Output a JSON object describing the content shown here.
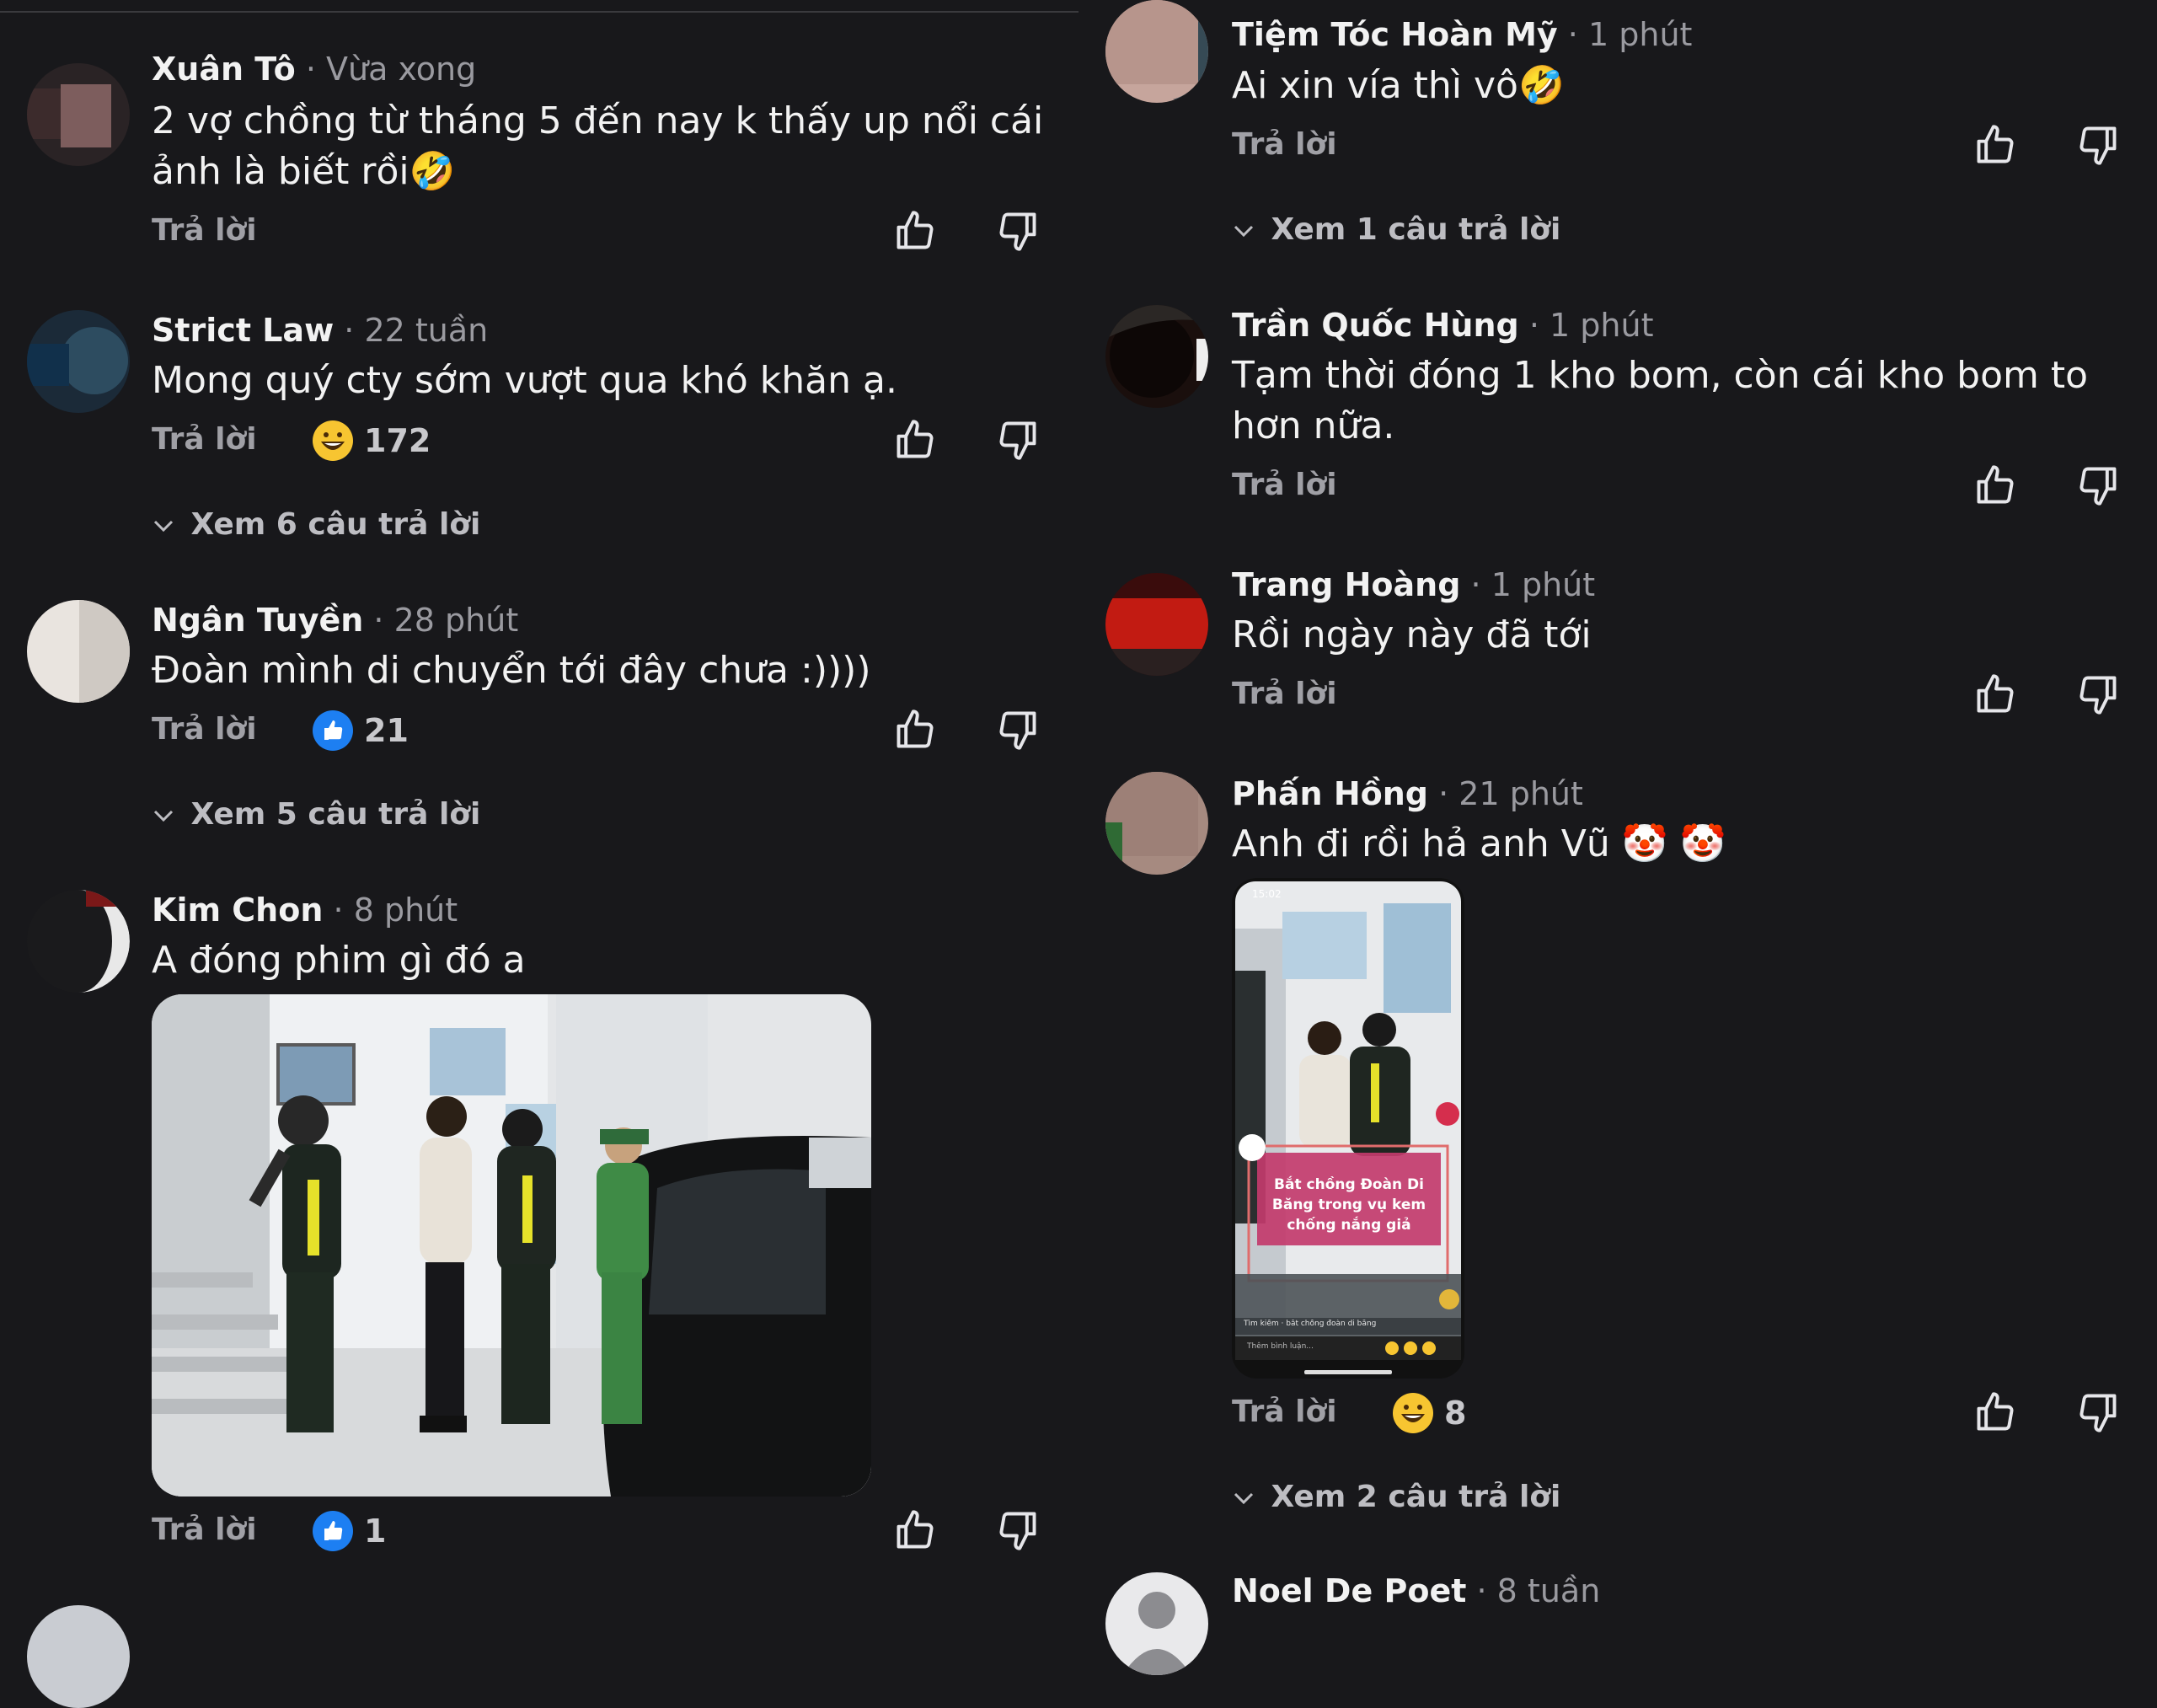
{
  "ui": {
    "reply_label": "Trả lời",
    "dot": "·",
    "accent_blue": "#1d7ff2",
    "emoji_yellow": "#f7c531"
  },
  "left": [
    {
      "name": "Xuân Tô",
      "time": "Vừa xong",
      "text": "2 vợ chồng từ tháng 5 đến nay k thấy up nổi cái ảnh là biết rồi🤣"
    },
    {
      "name": "Strict Law",
      "time": "22 tuần",
      "text": "Mong quý cty sớm vượt qua khó khăn ạ.",
      "reaction_count": "172",
      "reaction_icon": "haha-emoji-icon",
      "more_replies": "Xem 6 câu trả lời"
    },
    {
      "name": "Ngân Tuyền",
      "time": "28 phút",
      "text": "Đoàn mình di chuyển tới đây chưa :))))",
      "reaction_count": "21",
      "reaction_icon": "like-emoji-icon",
      "more_replies": "Xem 5 câu trả lời"
    },
    {
      "name": "Kim Chon",
      "time": "8 phút",
      "text": "A đóng phim gì đó a",
      "reaction_count": "1",
      "reaction_icon": "like-emoji-icon"
    }
  ],
  "right": [
    {
      "name": "Tiệm Tóc Hoàn Mỹ",
      "time": "1 phút",
      "text": "Ai xin vía thì vô🤣",
      "more_replies": "Xem 1 câu trả lời"
    },
    {
      "name": "Trần Quốc Hùng",
      "time": "1 phút",
      "text": "Tạm thời đóng 1 kho bom, còn cái kho bom to hơn nữa."
    },
    {
      "name": "Trang Hoàng",
      "time": "1 phút",
      "text": "Rồi ngày này đã tới"
    },
    {
      "name": "Phấn Hồng",
      "time": "21 phút",
      "text": "Anh đi rồi hả anh Vũ 🤡 🤡",
      "reaction_count": "8",
      "reaction_icon": "haha-emoji-icon",
      "more_replies": "Xem 2 câu trả lời",
      "screenshot": {
        "caption": "Bắt chồng Đoàn Di Băng trong vụ kem chống nắng giả",
        "status_time": "15:02",
        "search_text": "Tìm kiếm · bắt chồng đoàn di băng",
        "comment_placeholder": "Thêm bình luận..."
      }
    },
    {
      "name": "Noel De Poet",
      "time": "8 tuần"
    }
  ]
}
